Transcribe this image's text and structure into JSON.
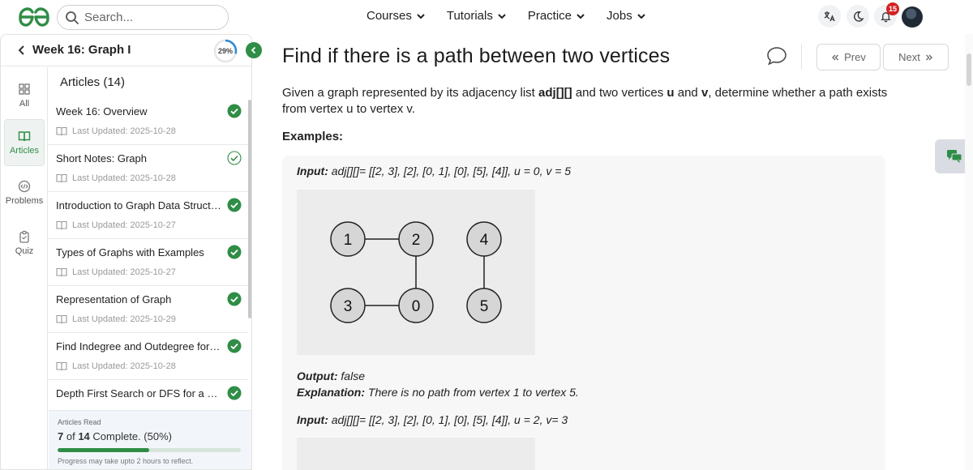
{
  "header": {
    "search_placeholder": "Search...",
    "nav": [
      "Courses",
      "Tutorials",
      "Practice",
      "Jobs"
    ],
    "notifications_count": "15"
  },
  "sidebar": {
    "week_title": "Week 16: Graph I",
    "progress_label": "29%",
    "progress_fraction": 0.29,
    "rail": [
      {
        "label": "All",
        "icon": "grid-icon",
        "active": false
      },
      {
        "label": "Articles",
        "icon": "book-icon",
        "active": true
      },
      {
        "label": "Problems",
        "icon": "code-icon",
        "active": false
      },
      {
        "label": "Quiz",
        "icon": "clipboard-icon",
        "active": false
      }
    ],
    "list_heading": "Articles (14)",
    "articles": [
      {
        "title": "Week 16: Overview",
        "updated": "Last Updated: 2025-10-28",
        "status": "done"
      },
      {
        "title": "Short Notes: Graph",
        "updated": "Last Updated: 2025-10-28",
        "status": "outline"
      },
      {
        "title": "Introduction to Graph Data Structure",
        "updated": "Last Updated: 2025-10-27",
        "status": "done"
      },
      {
        "title": "Types of Graphs with Examples",
        "updated": "Last Updated: 2025-10-27",
        "status": "done"
      },
      {
        "title": "Representation of Graph",
        "updated": "Last Updated: 2025-10-29",
        "status": "done"
      },
      {
        "title": "Find Indegree and Outdegree for all...",
        "updated": "Last Updated: 2025-10-28",
        "status": "done"
      },
      {
        "title": "Depth First Search or DFS for a Gra...",
        "updated": "",
        "status": "done"
      }
    ],
    "footer": {
      "label": "Articles Read",
      "read": "7",
      "of_text": "of",
      "total": "14",
      "complete_text": "Complete. (50%)",
      "fraction": 0.5,
      "note": "Progress may take upto 2 hours to reflect."
    }
  },
  "main": {
    "title": "Find if there is a path between two vertices",
    "prev_label": "Prev",
    "next_label": "Next",
    "intro": {
      "p1": "Given a graph represented by its adjacency list ",
      "adj": "adj[][]",
      "p2": " and two vertices ",
      "u": "u",
      "p3": " and ",
      "v": "v",
      "p4": ", determine whether a path exists from vertex u to vertex v."
    },
    "examples_heading": "Examples:",
    "example1": {
      "input_label": "Input:",
      "input_value": " adj[][]= [[2, 3], [2], [0, 1], [0], [5], [4]], u = 0, v = 5",
      "output_label": "Output:",
      "output_value": " false",
      "explanation_label": "Explanation:",
      "explanation_value": " There is no path from vertex 1 to vertex 5."
    },
    "example2": {
      "input_label": "Input:",
      "input_value": " adj[][]= [[2, 3], [2], [0, 1], [0], [5], [4]], u = 2, v= 3"
    },
    "graph_nodes": [
      "1",
      "2",
      "4",
      "3",
      "0",
      "5"
    ]
  },
  "colors": {
    "brand_green": "#2f8d46",
    "badge_red": "#d42222"
  }
}
